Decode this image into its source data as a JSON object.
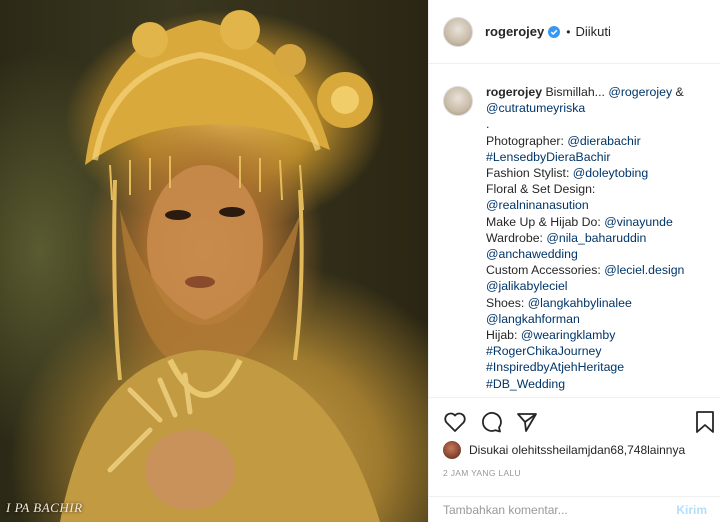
{
  "photo": {
    "watermark": "I    PA BACHIR"
  },
  "header": {
    "username": "rogerojey",
    "separator": "•",
    "follow_status": "Diikuti"
  },
  "caption": {
    "author": "rogerojey",
    "lines": [
      [
        {
          "t": "Bismillah... ",
          "m": false
        },
        {
          "t": "@rogerojey",
          "m": true
        },
        {
          "t": " &",
          "m": false
        }
      ],
      [
        {
          "t": "@cutratumeyriska",
          "m": true
        }
      ],
      [
        {
          "t": ".",
          "m": false
        }
      ],
      [
        {
          "t": "Photographer: ",
          "m": false
        },
        {
          "t": "@dierabachir",
          "m": true
        }
      ],
      [
        {
          "t": "#LensedbyDieraBachir",
          "m": true
        }
      ],
      [
        {
          "t": "Fashion Stylist: ",
          "m": false
        },
        {
          "t": "@doleytobing",
          "m": true
        }
      ],
      [
        {
          "t": "Floral & Set Design:",
          "m": false
        }
      ],
      [
        {
          "t": "@realninanasution",
          "m": true
        }
      ],
      [
        {
          "t": "Make Up & Hijab Do: ",
          "m": false
        },
        {
          "t": "@vinayunde",
          "m": true
        }
      ],
      [
        {
          "t": "Wardrobe: ",
          "m": false
        },
        {
          "t": "@nila_baharuddin",
          "m": true
        }
      ],
      [
        {
          "t": "@anchawedding",
          "m": true
        }
      ],
      [
        {
          "t": "Custom Accessories: ",
          "m": false
        },
        {
          "t": "@leciel.design",
          "m": true
        }
      ],
      [
        {
          "t": "@jalikabyleciel",
          "m": true
        }
      ],
      [
        {
          "t": "Shoes: ",
          "m": false
        },
        {
          "t": "@langkahbylinalee",
          "m": true
        }
      ],
      [
        {
          "t": "@langkahforman",
          "m": true
        }
      ],
      [
        {
          "t": "Hijab: ",
          "m": false
        },
        {
          "t": "@wearingklamby",
          "m": true
        }
      ],
      [
        {
          "t": "#RogerChikaJourney",
          "m": true
        }
      ],
      [
        {
          "t": "#InspiredbyAtjehHeritage",
          "m": true
        }
      ],
      [
        {
          "t": "#DB_Wedding",
          "m": true
        }
      ]
    ]
  },
  "actions": {
    "icons": [
      "heart-icon",
      "comment-icon",
      "share-icon",
      "bookmark-icon"
    ]
  },
  "likes": {
    "prefix": "Disukai oleh ",
    "user": "itssheilamj",
    "middle": " dan ",
    "count": "68,748",
    "suffix": " lainnya"
  },
  "timestamp": "2 JAM YANG LALU",
  "add_comment": {
    "placeholder": "Tambahkan komentar...",
    "post_label": "Kirim"
  },
  "colors": {
    "mention": "#003569",
    "verified": "#3897f0",
    "post_disabled": "#b2dffc"
  }
}
